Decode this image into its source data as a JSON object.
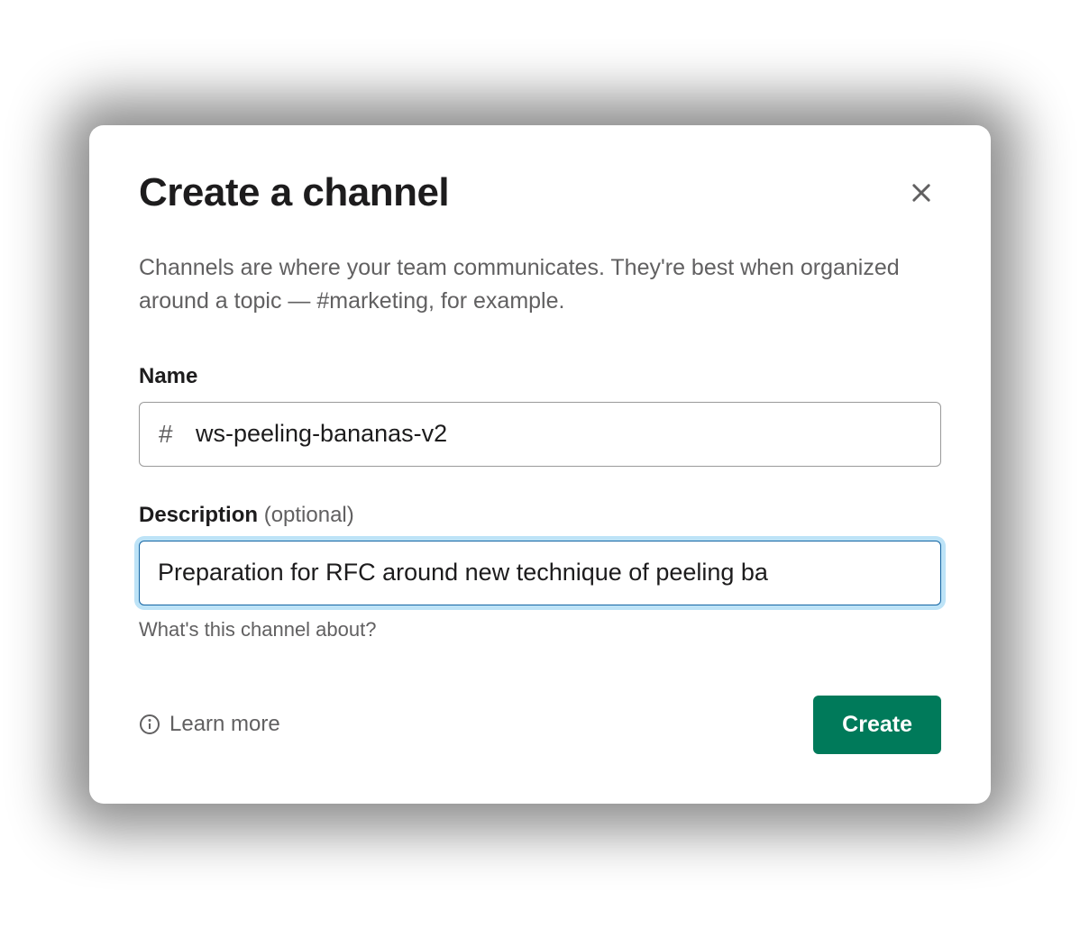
{
  "modal": {
    "title": "Create a channel",
    "description": "Channels are where your team communicates. They're best when organized around a topic — #marketing, for example.",
    "name_field": {
      "label": "Name",
      "prefix": "#",
      "value": "ws-peeling-bananas-v2"
    },
    "description_field": {
      "label": "Description",
      "optional_text": "(optional)",
      "value": "Preparation for RFC around new technique of peeling ba",
      "hint": "What's this channel about?"
    },
    "footer": {
      "learn_more": "Learn more",
      "create_button": "Create"
    }
  }
}
